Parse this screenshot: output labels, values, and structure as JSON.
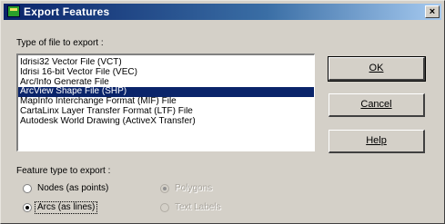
{
  "window": {
    "title": "Export Features",
    "close_glyph": "×"
  },
  "file_type": {
    "label": "Type of file to export :",
    "items": [
      {
        "label": "Idrisi32 Vector File (VCT)",
        "selected": false
      },
      {
        "label": "Idrisi 16-bit Vector File (VEC)",
        "selected": false
      },
      {
        "label": "Arc/Info Generate File",
        "selected": false
      },
      {
        "label": "ArcView Shape File (SHP)",
        "selected": true
      },
      {
        "label": "MapInfo Interchange Format (MIF) File",
        "selected": false
      },
      {
        "label": "CartaLinx Layer Transfer Format (LTF) File",
        "selected": false
      },
      {
        "label": "Autodesk World Drawing (ActiveX Transfer)",
        "selected": false
      }
    ]
  },
  "buttons": {
    "ok": "OK",
    "cancel": "Cancel",
    "help": "Help"
  },
  "feature_type": {
    "label": "Feature type to export :",
    "options": [
      {
        "label": "Nodes (as points)",
        "checked": false,
        "enabled": true
      },
      {
        "label": "Arcs (as lines)",
        "checked": true,
        "enabled": true
      },
      {
        "label": "Polygons",
        "checked": true,
        "enabled": false
      },
      {
        "label": "Text Labels",
        "checked": false,
        "enabled": false
      }
    ]
  }
}
